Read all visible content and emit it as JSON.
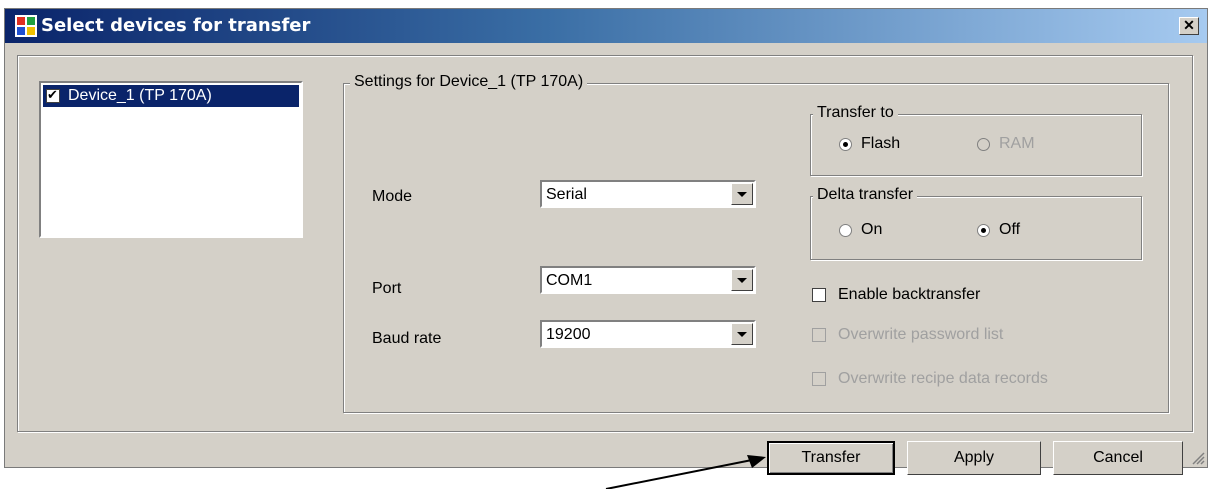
{
  "window": {
    "title": "Select devices for transfer",
    "close_glyph": "✕"
  },
  "device_list": {
    "items": [
      {
        "label": "Device_1 (TP 170A)",
        "checked": true
      }
    ]
  },
  "settings": {
    "group_title": "Settings for Device_1 (TP 170A)",
    "mode": {
      "label": "Mode",
      "value": "Serial"
    },
    "port": {
      "label": "Port",
      "value": "COM1"
    },
    "baud": {
      "label": "Baud rate",
      "value": "19200"
    },
    "transfer_to": {
      "title": "Transfer to",
      "flash": "Flash",
      "ram": "RAM",
      "selected": "Flash"
    },
    "delta_transfer": {
      "title": "Delta transfer",
      "on": "On",
      "off": "Off",
      "selected": "Off"
    },
    "enable_backtransfer": "Enable backtransfer",
    "overwrite_password": "Overwrite password list",
    "overwrite_recipe": "Overwrite recipe data records"
  },
  "buttons": {
    "transfer": "Transfer",
    "apply": "Apply",
    "cancel": "Cancel"
  },
  "icons": {
    "app": "app-windows-icon",
    "close": "close-icon",
    "dropdown": "chevron-down-icon",
    "grip": "resize-grip-icon"
  },
  "colors": {
    "selection": "#0a246a",
    "face": "#d4d0c8"
  }
}
